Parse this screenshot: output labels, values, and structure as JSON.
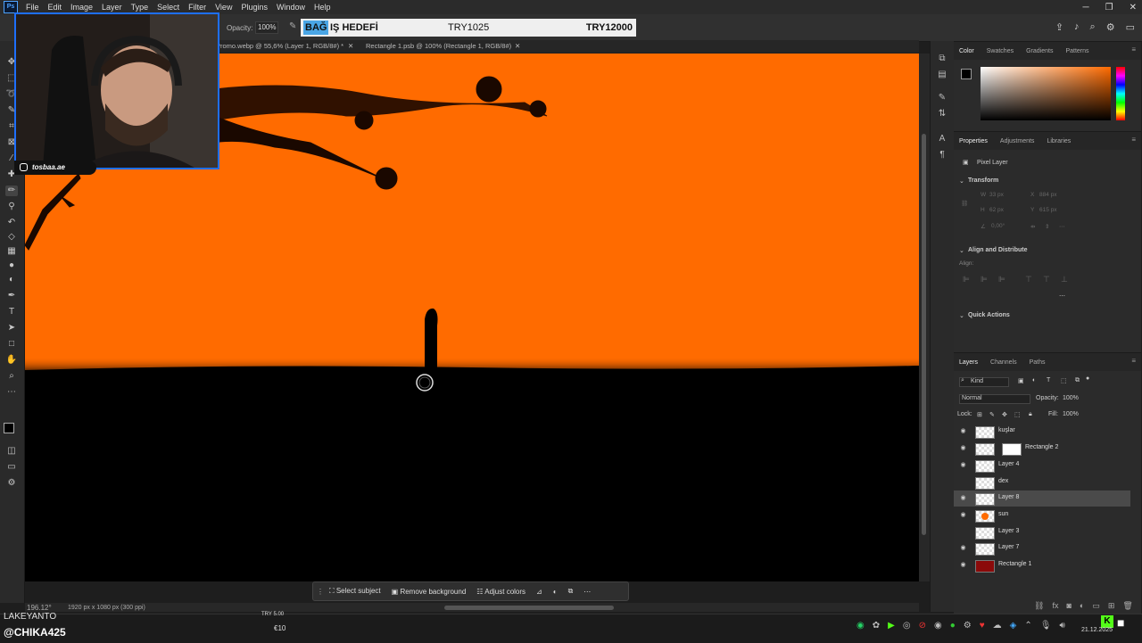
{
  "menu": [
    "File",
    "Edit",
    "Image",
    "Layer",
    "Type",
    "Select",
    "Filter",
    "View",
    "Plugins",
    "Window",
    "Help"
  ],
  "options": {
    "opacity_label": "Opacity:",
    "opacity_value": "100%"
  },
  "donation": {
    "label_highlight": "BAĞ",
    "label_rest": "IŞ HEDEFİ",
    "current": "TRY1025",
    "goal": "TRY12000"
  },
  "tabs": [
    {
      "label": "Promo.webp @ 55,6% (Layer 1, RGB/8#) *"
    },
    {
      "label": "Rectangle 1.psb @ 100% (Rectangle 1, RGB/8#)"
    }
  ],
  "webcam": {
    "instagram_handle": "tosbaa.ae"
  },
  "contextual_bar": {
    "select_subject": "Select subject",
    "remove_background": "Remove background",
    "adjust_colors": "Adjust colors"
  },
  "status": {
    "zoom": "196.12°",
    "doc_info": "1920 px x 1080 px (300 ppi)"
  },
  "color_panel": {
    "tabs": [
      "Color",
      "Swatches",
      "Gradients",
      "Patterns"
    ],
    "fg_color": "#000000",
    "bg_color": "#ffffff",
    "accent": "#ff6b00"
  },
  "properties": {
    "tabs": [
      "Properties",
      "Adjustments",
      "Libraries"
    ],
    "kind": "Pixel Layer",
    "transform": "Transform",
    "w": "W",
    "w_val": "33 px",
    "x": "X",
    "x_val": "884 px",
    "h": "H",
    "h_val": "62 px",
    "y": "Y",
    "y_val": "615 px",
    "angle_val": "0,00°",
    "align_title": "Align and Distribute",
    "align_label": "Align:",
    "quick_actions": "Quick Actions"
  },
  "layers": {
    "tabs": [
      "Layers",
      "Channels",
      "Paths"
    ],
    "filter": "Kind",
    "blend_mode": "Normal",
    "opacity_label": "Opacity:",
    "opacity_value": "100%",
    "lock_label": "Lock:",
    "fill_label": "Fill:",
    "fill_value": "100%",
    "items": [
      {
        "name": "kuşlar",
        "visible": true,
        "selected": false
      },
      {
        "name": "Rectangle 2",
        "visible": true,
        "selected": false
      },
      {
        "name": "Layer 4",
        "visible": true,
        "selected": false
      },
      {
        "name": "dex",
        "visible": false,
        "selected": false
      },
      {
        "name": "Layer 8",
        "visible": true,
        "selected": true
      },
      {
        "name": "sun",
        "visible": true,
        "selected": false
      },
      {
        "name": "Layer 3",
        "visible": false,
        "selected": false
      },
      {
        "name": "Layer 7",
        "visible": true,
        "selected": false
      },
      {
        "name": "Rectangle 1",
        "visible": true,
        "selected": false
      }
    ]
  },
  "overlay": {
    "streamer_name": "LAKEYANTO",
    "handle": "@CHIKA425",
    "tray_try": "TRY 5.00",
    "tray_amount": "€10"
  },
  "clock": {
    "date": "21.12.2025"
  }
}
